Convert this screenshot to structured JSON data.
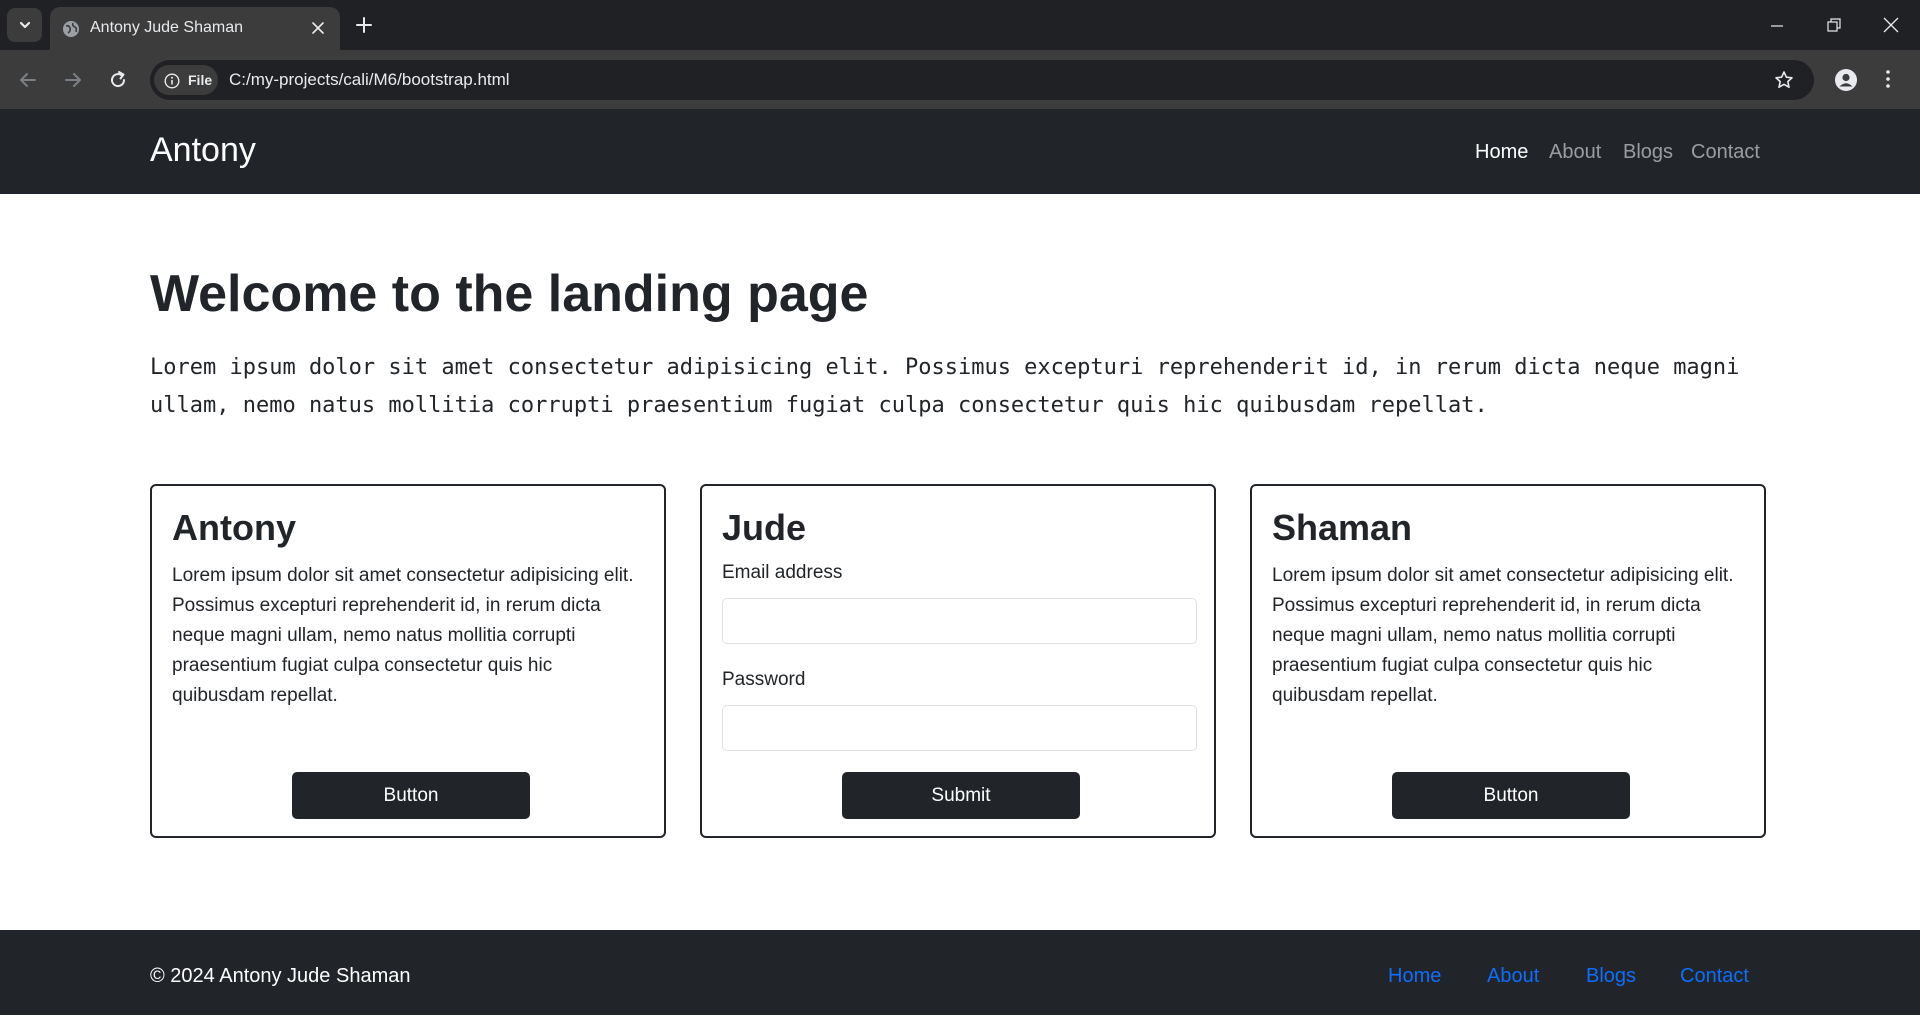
{
  "browser": {
    "tab_title": "Antony Jude Shaman",
    "site_chip_label": "File",
    "url": "C:/my-projects/cali/M6/bootstrap.html"
  },
  "navbar": {
    "brand": "Antony",
    "links": [
      {
        "label": "Home",
        "active": true
      },
      {
        "label": "About",
        "active": false
      },
      {
        "label": "Blogs",
        "active": false
      },
      {
        "label": "Contact",
        "active": false
      }
    ]
  },
  "hero": {
    "title": "Welcome to the landing page",
    "text": "Lorem ipsum dolor sit amet consectetur adipisicing elit. Possimus excepturi reprehenderit id, in rerum dicta neque magni ullam, nemo natus mollitia corrupti praesentium fugiat culpa consectetur quis hic quibusdam repellat."
  },
  "cards": [
    {
      "title": "Antony",
      "text": "Lorem ipsum dolor sit amet consectetur adipisicing elit. Possimus excepturi reprehenderit id, in rerum dicta neque magni ullam, nemo natus mollitia corrupti praesentium fugiat culpa consectetur quis hic quibusdam repellat.",
      "button_label": "Button"
    },
    {
      "title": "Jude",
      "email_label": "Email address",
      "email_value": "",
      "password_label": "Password",
      "password_value": "",
      "button_label": "Submit"
    },
    {
      "title": "Shaman",
      "text": "Lorem ipsum dolor sit amet consectetur adipisicing elit. Possimus excepturi reprehenderit id, in rerum dicta neque magni ullam, nemo natus mollitia corrupti praesentium fugiat culpa consectetur quis hic quibusdam repellat.",
      "button_label": "Button"
    }
  ],
  "footer": {
    "copyright": "© 2024 Antony Jude Shaman",
    "links": [
      "Home",
      "About",
      "Blogs",
      "Contact"
    ]
  },
  "colors": {
    "dark": "#212529",
    "link_blue": "#0d6efd",
    "chrome_dark": "#202124",
    "chrome_mid": "#3c3c3c"
  },
  "icons": {
    "tab_list": "chevron-down-icon",
    "favicon": "globe-icon",
    "tab_close": "close-icon",
    "new_tab": "plus-icon",
    "back": "arrow-left-icon",
    "forward": "arrow-right-icon",
    "reload": "reload-icon",
    "site_info": "info-icon",
    "bookmark": "star-icon",
    "profile": "user-icon",
    "menu": "kebab-menu-icon"
  }
}
